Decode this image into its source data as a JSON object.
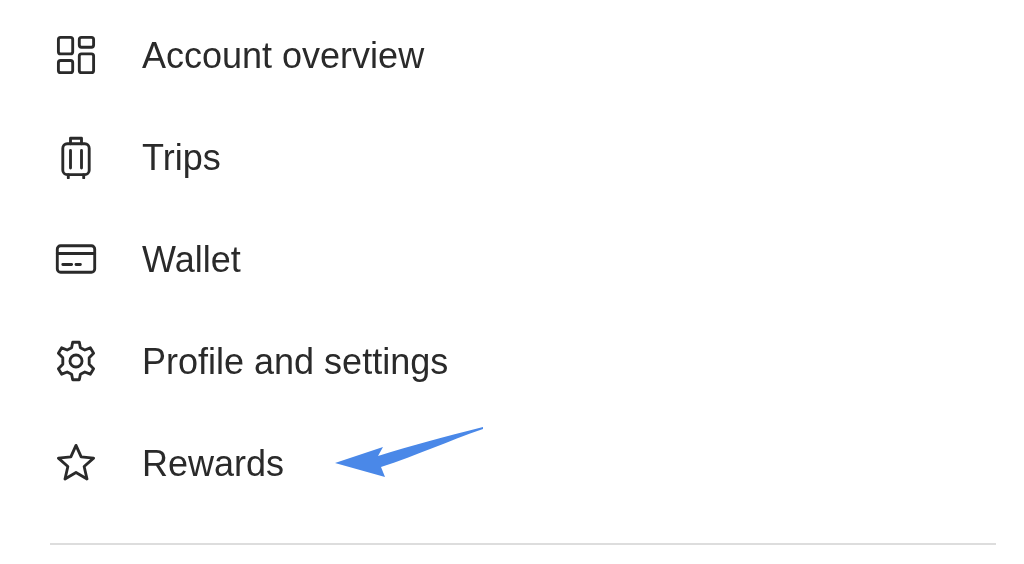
{
  "menu": {
    "items": [
      {
        "label": "Account overview"
      },
      {
        "label": "Trips"
      },
      {
        "label": "Wallet"
      },
      {
        "label": "Profile and settings"
      },
      {
        "label": "Rewards"
      }
    ]
  }
}
